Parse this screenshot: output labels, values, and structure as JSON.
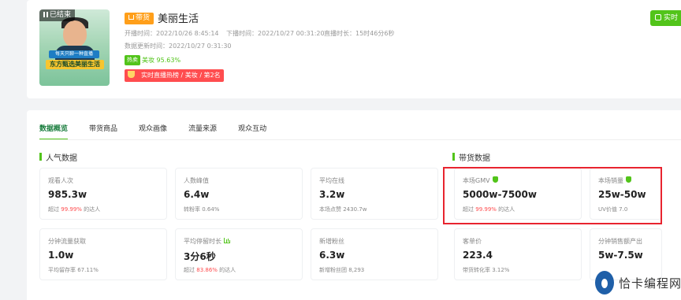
{
  "live": {
    "status_badge": "已结束",
    "thumb_banner_top": "每天只聊一种直播",
    "thumb_banner": "东方甄选美丽生活",
    "goods_tag": "带货",
    "title": "美丽生活",
    "start_label": "开播时间：",
    "start_time": "2022/10/26 8:45:14",
    "end_label": "下播时间：",
    "end_time": "2022/10/27 00:31:20",
    "duration_label": "直播时长：",
    "duration": "15时46分6秒",
    "updated_label": "数据更新时间：",
    "updated_time": "2022/10/27 0:31:30",
    "hot_tag": "热卖",
    "hot_text": "美妆 95.63%",
    "rank_text": "实时直播热榜 / 美妆 / 第2名",
    "real_button": "实时"
  },
  "tabs": [
    "数据概览",
    "带货商品",
    "观众画像",
    "流量来源",
    "观众互动"
  ],
  "sections": {
    "popularity": "人气数据",
    "sales": "带货数据"
  },
  "metrics": [
    {
      "label": "观看人次",
      "value": "985.3w",
      "sub_prefix": "超过 ",
      "sub_red": "99.99%",
      "sub_suffix": " 的达人"
    },
    {
      "label": "人数峰值",
      "value": "6.4w",
      "sub_prefix": "转粉率 0.64%",
      "sub_red": "",
      "sub_suffix": ""
    },
    {
      "label": "平均在线",
      "value": "3.2w",
      "sub_prefix": "本场点赞 2430.7w",
      "sub_red": "",
      "sub_suffix": ""
    },
    {
      "label": "本场GMV",
      "value": "5000w-7500w",
      "sub_prefix": "超过 ",
      "sub_red": "99.99%",
      "sub_suffix": " 的达人"
    },
    {
      "label": "本场销量",
      "value": "25w-50w",
      "sub_prefix": "UV价值 7.0",
      "sub_red": "",
      "sub_suffix": ""
    },
    {
      "label": "分钟流量获取",
      "value": "1.0w",
      "sub_prefix": "平均留存率 67.11%",
      "sub_red": "",
      "sub_suffix": ""
    },
    {
      "label": "平均停留时长",
      "value": "3分6秒",
      "sub_prefix": "超过 ",
      "sub_red": "83.86%",
      "sub_suffix": " 的达人"
    },
    {
      "label": "新增粉丝",
      "value": "6.3w",
      "sub_prefix": "新增粉丝团 8,293",
      "sub_red": "",
      "sub_suffix": ""
    },
    {
      "label": "客单价",
      "value": "223.4",
      "sub_prefix": "带货转化率 3.12%",
      "sub_red": "",
      "sub_suffix": ""
    },
    {
      "label": "分钟销售额产出",
      "value": "5w-7.5w",
      "sub_prefix": "",
      "sub_red": "",
      "sub_suffix": ""
    }
  ],
  "watermark": "恰卡编程网",
  "colors": {
    "accent": "#52c41a",
    "highlight": "#e8242f",
    "warn": "#ff4d4f",
    "goods_tag": "#ff9f1a"
  }
}
